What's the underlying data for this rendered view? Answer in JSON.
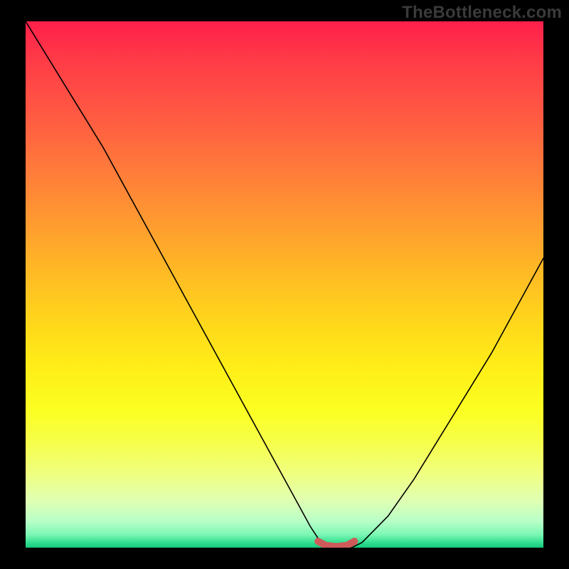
{
  "watermark": "TheBottleneck.com",
  "chart_data": {
    "type": "line",
    "title": "",
    "xlabel": "",
    "ylabel": "",
    "xlim": [
      0,
      100
    ],
    "ylim": [
      0,
      100
    ],
    "x": [
      0,
      5,
      10,
      15,
      20,
      25,
      30,
      35,
      40,
      45,
      50,
      55,
      57,
      60,
      63,
      65,
      70,
      75,
      80,
      85,
      90,
      95,
      100
    ],
    "values": [
      100,
      92,
      84,
      76,
      67,
      58,
      49,
      40,
      31,
      22,
      13,
      4,
      1,
      0,
      0,
      1,
      6,
      13,
      21,
      29,
      37,
      46,
      55
    ],
    "marker_segment": {
      "x": [
        56.5,
        58,
        60,
        62,
        63.5
      ],
      "y": [
        1.2,
        0.4,
        0.2,
        0.4,
        1.2
      ]
    },
    "annotations": []
  }
}
